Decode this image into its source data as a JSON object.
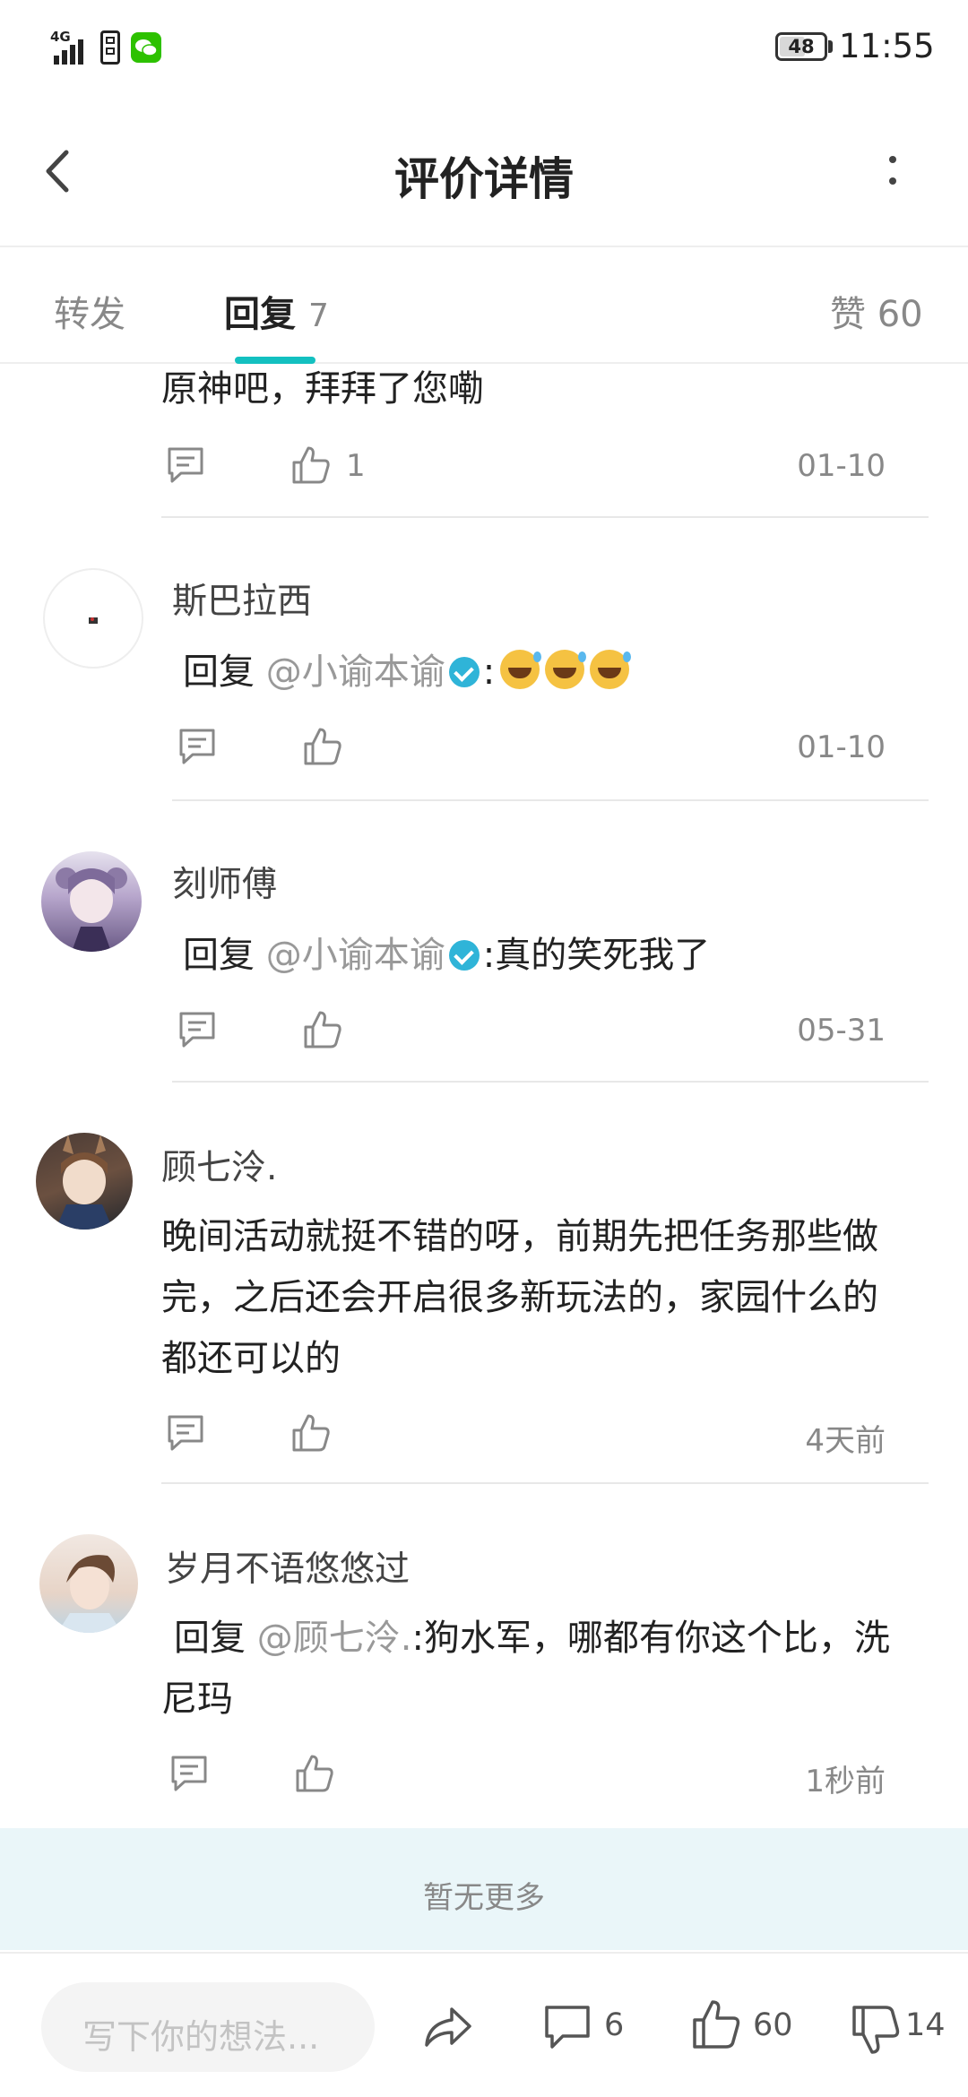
{
  "status_bar": {
    "network": "4G",
    "battery": "48",
    "time": "11:55"
  },
  "header": {
    "title": "评价详情"
  },
  "tabs": {
    "forward": "转发",
    "reply": "回复",
    "reply_count": "7",
    "like": "赞 60"
  },
  "comments": [
    {
      "text": "原神吧，拜拜了您嘞",
      "like_count": "1",
      "date": "01-10"
    },
    {
      "author": "斯巴拉西",
      "reply_prefix": "回复",
      "mention": "@小谕本谕",
      "text": ":",
      "emoji_count": 3,
      "date": "01-10"
    },
    {
      "author": "刻师傅",
      "reply_prefix": "回复",
      "mention": "@小谕本谕",
      "text": ":真的笑死我了",
      "date": "05-31"
    },
    {
      "author": "顾七泠.",
      "text_lines": [
        "晚间活动就挺不错的呀，前期先把任务那些做",
        "完，之后还会开启很多新玩法的，家园什么的",
        "都还可以的"
      ],
      "date": "4天前"
    },
    {
      "author": "岁月不语悠悠过",
      "reply_prefix": "回复",
      "mention": "@顾七泠.",
      "text": ":狗水军，哪都有你这个比，洗",
      "text2": "尼玛",
      "date": "1秒前"
    }
  ],
  "end_text": "暂无更多",
  "bottom_bar": {
    "placeholder": "写下你的想法...",
    "comment_count": "6",
    "like_count": "60",
    "dislike_count": "14"
  },
  "colors": {
    "accent": "#13c0c0",
    "end_bar_bg": "#eaf6f9",
    "verified_badge": "#2fb4d8"
  }
}
